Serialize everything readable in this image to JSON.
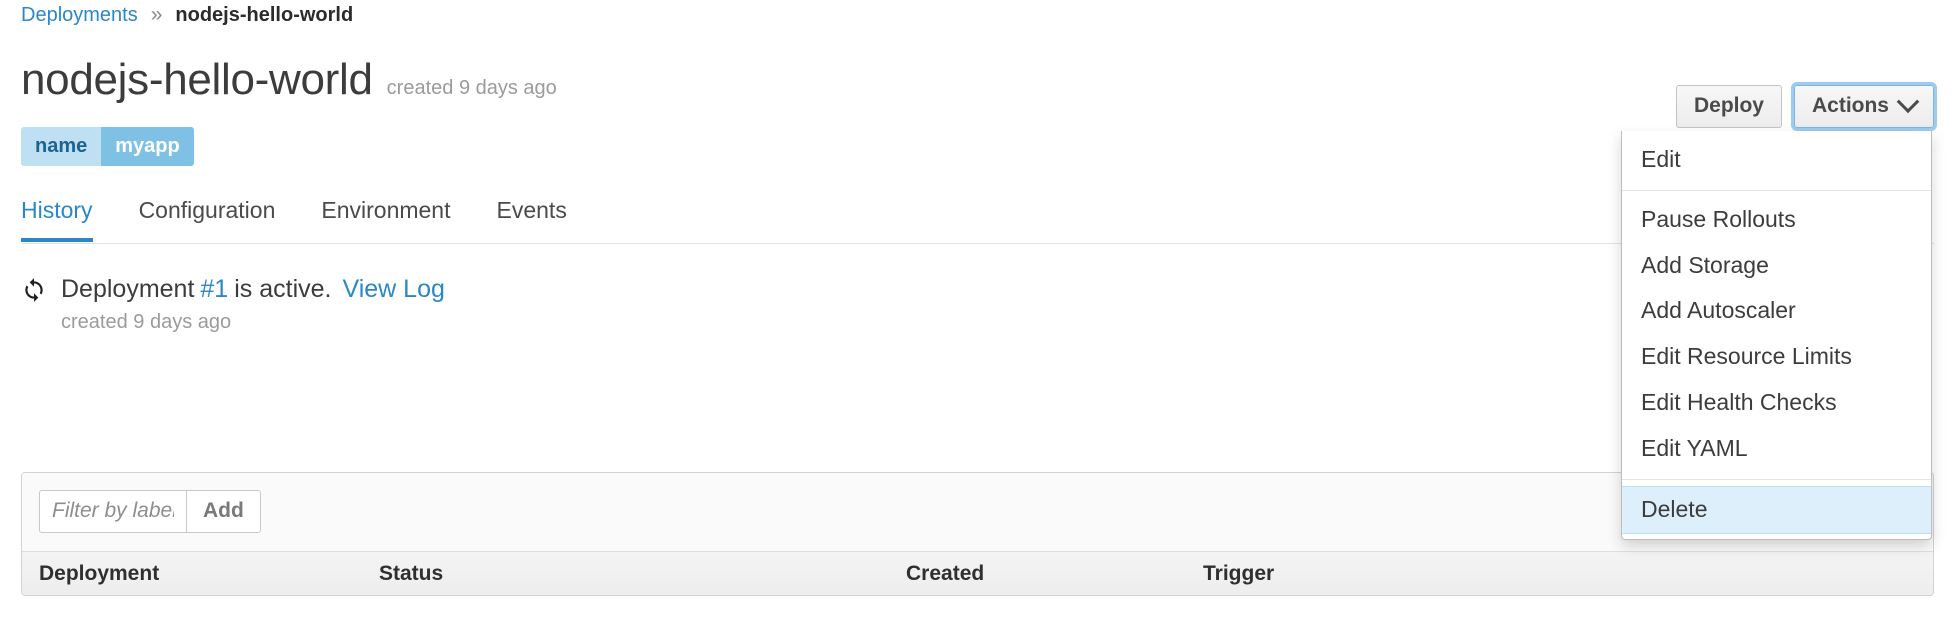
{
  "breadcrumb": {
    "parent": "Deployments",
    "separator": "»",
    "current": "nodejs-hello-world"
  },
  "header": {
    "title": "nodejs-hello-world",
    "subtitle": "created 9 days ago"
  },
  "toolbar": {
    "deploy_label": "Deploy",
    "actions_label": "Actions",
    "chevron_icon": "chevron-down-icon"
  },
  "labels": [
    {
      "key": "name",
      "value": "myapp"
    }
  ],
  "tabs": [
    {
      "label": "History",
      "active": true
    },
    {
      "label": "Configuration",
      "active": false
    },
    {
      "label": "Environment",
      "active": false
    },
    {
      "label": "Events",
      "active": false
    }
  ],
  "deployment_status": {
    "icon": "refresh-icon",
    "prefix": "Deployment",
    "number": "#1",
    "suffix": "is active.",
    "view_log_label": "View Log",
    "created": "created 9 days ago"
  },
  "panel": {
    "filter_placeholder": "Filter by label",
    "filter_value": "",
    "add_label": "Add",
    "columns": [
      "Deployment",
      "Status",
      "Created",
      "Trigger"
    ]
  },
  "actions_menu": {
    "items": [
      {
        "label": "Edit",
        "highlight": false,
        "divider_after": true
      },
      {
        "label": "Pause Rollouts",
        "highlight": false,
        "divider_after": false
      },
      {
        "label": "Add Storage",
        "highlight": false,
        "divider_after": false
      },
      {
        "label": "Add Autoscaler",
        "highlight": false,
        "divider_after": false
      },
      {
        "label": "Edit Resource Limits",
        "highlight": false,
        "divider_after": false
      },
      {
        "label": "Edit Health Checks",
        "highlight": false,
        "divider_after": false
      },
      {
        "label": "Edit YAML",
        "highlight": false,
        "divider_after": true
      },
      {
        "label": "Delete",
        "highlight": true,
        "divider_after": false
      }
    ]
  },
  "colors": {
    "link": "#2a88c8",
    "badge_key_bg": "#bfe0f2",
    "badge_value_bg": "#7fc0e5",
    "focus_ring": "#9ecbf0",
    "menu_highlight_bg": "#ddeffb"
  }
}
